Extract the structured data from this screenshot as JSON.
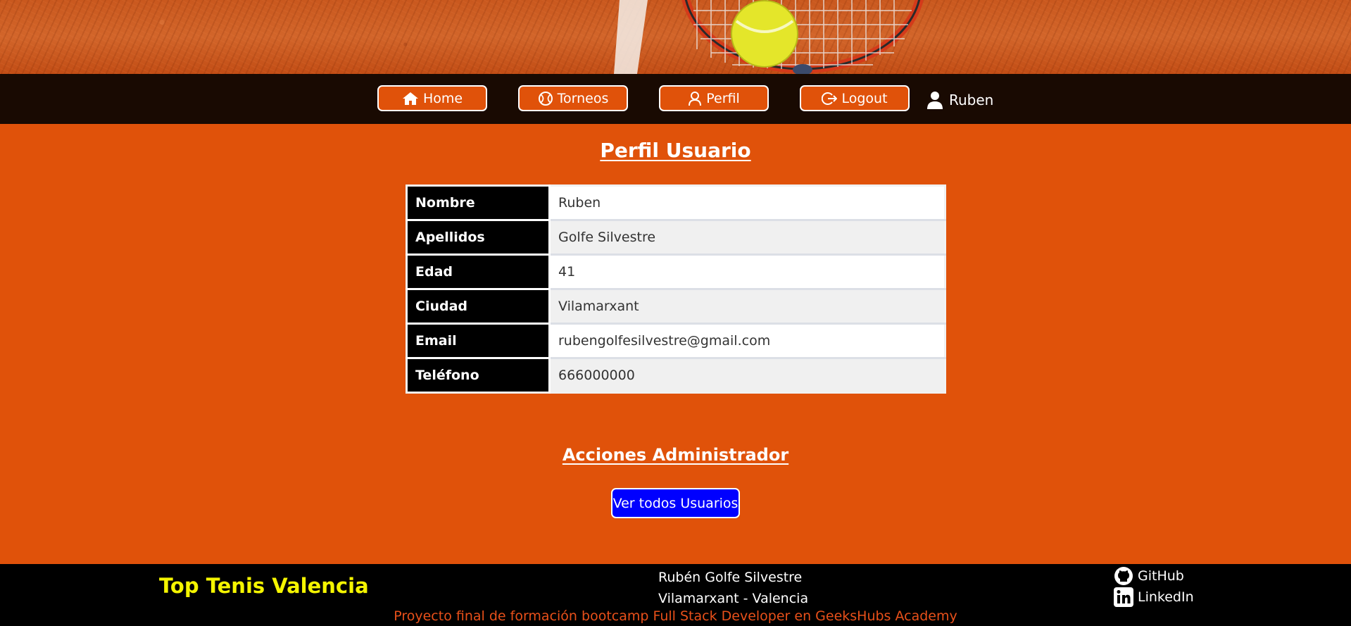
{
  "nav": {
    "home": "Home",
    "torneos": "Torneos",
    "perfil": "Perfil",
    "logout": "Logout",
    "user": "Ruben"
  },
  "profile": {
    "title": "Perfil Usuario",
    "rows": [
      {
        "label": "Nombre",
        "value": "Ruben"
      },
      {
        "label": "Apellidos",
        "value": "Golfe Silvestre"
      },
      {
        "label": "Edad",
        "value": "41"
      },
      {
        "label": "Ciudad",
        "value": "Vilamarxant"
      },
      {
        "label": "Email",
        "value": "rubengolfesilvestre@gmail.com"
      },
      {
        "label": "Teléfono",
        "value": "666000000"
      }
    ]
  },
  "admin": {
    "title": "Acciones Administrador",
    "button": "Ver todos Usuarios"
  },
  "footer": {
    "brand": "Top Tenis Valencia",
    "author_name": "Rubén Golfe Silvestre",
    "author_location": "Vilamarxant - Valencia",
    "credits": "Proyecto final de formación bootcamp Full Stack Developer en GeeksHubs Academy",
    "github": "GitHub",
    "linkedin": "LinkedIn"
  },
  "colors": {
    "accent": "#e0520a",
    "navbar": "#190a02",
    "admin_button": "#0000ff",
    "brand": "#f5f500"
  }
}
